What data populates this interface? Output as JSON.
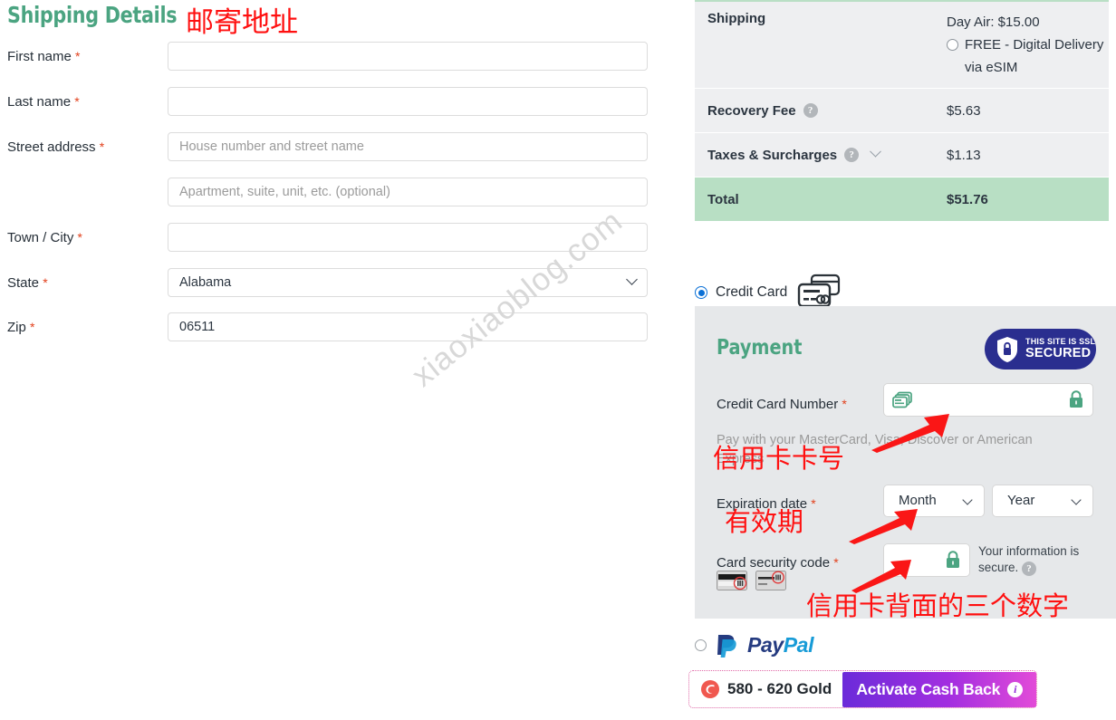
{
  "watermark": {
    "text": "xiaoxiaoblog.com"
  },
  "shipping": {
    "title": "Shipping Details",
    "annotation_cn": "邮寄地址",
    "required_mark": "*",
    "fields": [
      {
        "label": "First name",
        "value": "",
        "placeholder": "",
        "type": "text"
      },
      {
        "label": "Last name",
        "value": "",
        "placeholder": "",
        "type": "text"
      },
      {
        "label": "Street address",
        "value": "",
        "placeholder": "House number and street name",
        "type": "text"
      },
      {
        "label": "",
        "value": "",
        "placeholder": "Apartment, suite, unit, etc. (optional)",
        "type": "text"
      },
      {
        "label": "Town / City",
        "value": "",
        "placeholder": "",
        "type": "text"
      },
      {
        "label": "State",
        "value": "Alabama",
        "placeholder": "",
        "type": "select"
      },
      {
        "label": "Zip",
        "value": "06511",
        "placeholder": "",
        "type": "text"
      }
    ]
  },
  "summary": {
    "rows": [
      {
        "label": "Shipping",
        "value": "Day Air: $15.00",
        "option_label": "FREE - Digital Delivery via eSIM",
        "trailing": "-"
      },
      {
        "label": "Recovery Fee",
        "value": "$5.63"
      },
      {
        "label": "Taxes & Surcharges",
        "value": "$1.13"
      },
      {
        "label": "Total",
        "value": "$51.76"
      }
    ],
    "help_glyph": "?",
    "total_bg": "#b8dfc4"
  },
  "payment_methods": {
    "credit_card_label": "Credit Card",
    "paypal_pay": "Pay",
    "paypal_pal": "Pal"
  },
  "payment": {
    "title": "Payment",
    "ssl_badge_line1": "THIS SITE IS SSL",
    "ssl_badge_line2": "SECURED",
    "card_number_label": "Credit Card Number",
    "card_number_value": "",
    "card_number_hint": "Pay with your MasterCard, Visa, Discover or American Express",
    "expiration_label": "Expiration date",
    "month_value": "Month",
    "year_value": "Year",
    "csc_label": "Card security code",
    "csc_value": "",
    "secure_note": "Your information is secure.",
    "help_glyph": "?",
    "required_mark": "*",
    "annotation_card_cn": "信用卡卡号",
    "annotation_exp_cn": "有效期",
    "annotation_csc_cn": "信用卡背面的三个数字"
  },
  "cashback": {
    "tier_label": "580 - 620 Gold",
    "button_label": "Activate Cash Back",
    "info_glyph": "i"
  },
  "colors": {
    "heading_green": "#4ba481",
    "total_green": "#b8dfc4",
    "panel_gray": "#e6e8ea",
    "annotation_red": "#ff1010",
    "ssl_blue": "#2a2e8f",
    "paypal_dark": "#253b80",
    "paypal_light": "#179bd7"
  }
}
